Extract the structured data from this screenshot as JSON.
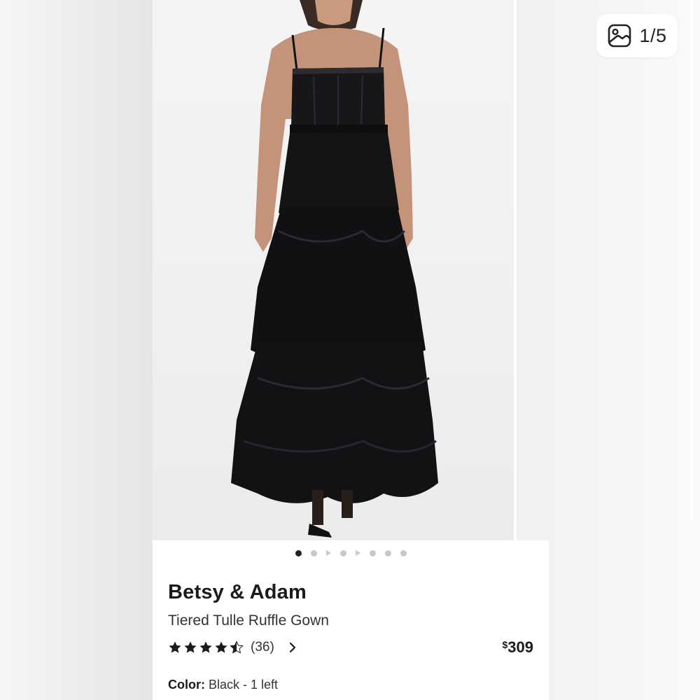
{
  "gallery": {
    "counter": "1/5",
    "dots": [
      "dot",
      "dot",
      "play",
      "dot",
      "play",
      "dot",
      "dot",
      "dot"
    ],
    "active_dot": 0
  },
  "product": {
    "brand": "Betsy & Adam",
    "name": "Tiered Tulle Ruffle Gown",
    "rating": 4.5,
    "review_count": "(36)",
    "price_currency": "$",
    "price_value": "309",
    "color_label": "Color:",
    "color_value": "Black - 1 left"
  },
  "colors": {
    "accent": "#1b1b1b",
    "dress": "#141416"
  },
  "icons": [
    "image-gallery-icon",
    "star-icon",
    "half-star-icon",
    "chevron-right-icon"
  ]
}
